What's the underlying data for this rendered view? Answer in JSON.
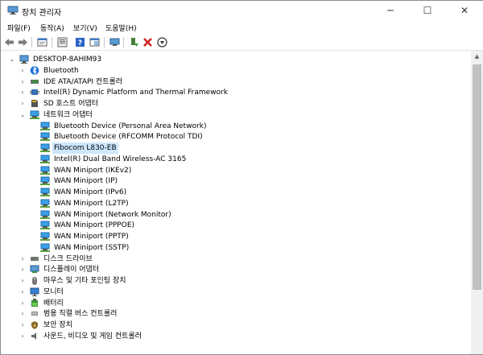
{
  "window": {
    "title": "장치 관리자",
    "minimize": "─",
    "maximize": "☐",
    "close": "✕"
  },
  "menu": [
    "파일(F)",
    "동작(A)",
    "보기(V)",
    "도움말(H)"
  ],
  "toolbar": [
    {
      "name": "back-icon"
    },
    {
      "name": "forward-icon"
    },
    {
      "name": "sep"
    },
    {
      "name": "properties-icon"
    },
    {
      "name": "sep"
    },
    {
      "name": "show-hidden-icon"
    },
    {
      "name": "help-icon"
    },
    {
      "name": "console-icon"
    },
    {
      "name": "sep"
    },
    {
      "name": "scan-hardware-icon"
    },
    {
      "name": "sep"
    },
    {
      "name": "update-driver-icon"
    },
    {
      "name": "uninstall-icon"
    },
    {
      "name": "disable-icon"
    }
  ],
  "tree": [
    {
      "label": "DESKTOP-8AHIM93",
      "level": 0,
      "expander": "expanded",
      "icon": "computer"
    },
    {
      "label": "Bluetooth",
      "level": 1,
      "expander": "collapsed",
      "icon": "bluetooth"
    },
    {
      "label": "IDE ATA/ATAPI 컨트롤러",
      "level": 1,
      "expander": "collapsed",
      "icon": "ide"
    },
    {
      "label": "Intel(R) Dynamic Platform and Thermal Framework",
      "level": 1,
      "expander": "collapsed",
      "icon": "chip"
    },
    {
      "label": "SD 호스트 어댑터",
      "level": 1,
      "expander": "collapsed",
      "icon": "sd"
    },
    {
      "label": "네트워크 어댑터",
      "level": 1,
      "expander": "expanded",
      "icon": "network"
    },
    {
      "label": "Bluetooth Device (Personal Area Network)",
      "level": 2,
      "expander": "none",
      "icon": "network"
    },
    {
      "label": "Bluetooth Device (RFCOMM Protocol TDI)",
      "level": 2,
      "expander": "none",
      "icon": "network"
    },
    {
      "label": "Fibocom L830-EB",
      "level": 2,
      "expander": "none",
      "icon": "network",
      "selected": true
    },
    {
      "label": "Intel(R) Dual Band Wireless-AC 3165",
      "level": 2,
      "expander": "none",
      "icon": "network"
    },
    {
      "label": "WAN Miniport (IKEv2)",
      "level": 2,
      "expander": "none",
      "icon": "network"
    },
    {
      "label": "WAN Miniport (IP)",
      "level": 2,
      "expander": "none",
      "icon": "network"
    },
    {
      "label": "WAN Miniport (IPv6)",
      "level": 2,
      "expander": "none",
      "icon": "network"
    },
    {
      "label": "WAN Miniport (L2TP)",
      "level": 2,
      "expander": "none",
      "icon": "network"
    },
    {
      "label": "WAN Miniport (Network Monitor)",
      "level": 2,
      "expander": "none",
      "icon": "network"
    },
    {
      "label": "WAN Miniport (PPPOE)",
      "level": 2,
      "expander": "none",
      "icon": "network"
    },
    {
      "label": "WAN Miniport (PPTP)",
      "level": 2,
      "expander": "none",
      "icon": "network"
    },
    {
      "label": "WAN Miniport (SSTP)",
      "level": 2,
      "expander": "none",
      "icon": "network"
    },
    {
      "label": "디스크 드라이브",
      "level": 1,
      "expander": "collapsed",
      "icon": "disk"
    },
    {
      "label": "디스플레이 어댑터",
      "level": 1,
      "expander": "collapsed",
      "icon": "display"
    },
    {
      "label": "마우스 및 기타 포인팅 장치",
      "level": 1,
      "expander": "collapsed",
      "icon": "mouse"
    },
    {
      "label": "모니터",
      "level": 1,
      "expander": "collapsed",
      "icon": "monitor"
    },
    {
      "label": "배터리",
      "level": 1,
      "expander": "collapsed",
      "icon": "battery"
    },
    {
      "label": "범용 직렬 버스 컨트롤러",
      "level": 1,
      "expander": "collapsed",
      "icon": "usb"
    },
    {
      "label": "보안 장치",
      "level": 1,
      "expander": "collapsed",
      "icon": "security"
    },
    {
      "label": "사운드, 비디오 및 게임 컨트롤러",
      "level": 1,
      "expander": "collapsed",
      "icon": "sound"
    }
  ],
  "colors": {
    "selection": "#cce8ff",
    "accent": "#3a7bd5"
  }
}
